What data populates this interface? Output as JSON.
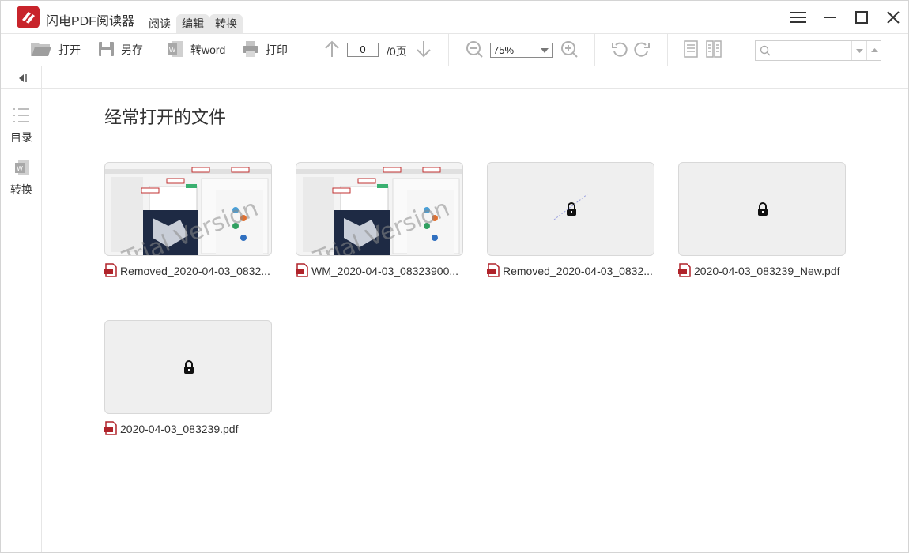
{
  "app": {
    "title": "闪电PDF阅读器"
  },
  "menu_tabs": [
    "阅读",
    "编辑",
    "转换"
  ],
  "toolbar": {
    "open_label": "打开",
    "save_as_label": "另存",
    "to_word_label": "转word",
    "print_label": "打印",
    "page_current": "0",
    "page_total": "/0页",
    "zoom": "75%",
    "search_placeholder": ""
  },
  "sidebar": {
    "toc_label": "目录",
    "convert_label": "转换"
  },
  "main": {
    "section_title": "经常打开的文件",
    "files": [
      {
        "name": "Removed_2020-04-03_0832...",
        "locked": false
      },
      {
        "name": "WM_2020-04-03_08323900...",
        "locked": false
      },
      {
        "name": "Removed_2020-04-03_0832...",
        "locked": true
      },
      {
        "name": "2020-04-03_083239_New.pdf",
        "locked": true
      },
      {
        "name": "2020-04-03_083239.pdf",
        "locked": true
      }
    ],
    "watermark_text": "Trial Version"
  },
  "colors": {
    "brand": "#c8242b",
    "pdf_icon": "#b0232a",
    "border": "#e6e6e6"
  },
  "icons": {
    "window": [
      "menu-icon",
      "minimize-icon",
      "maximize-icon",
      "close-icon"
    ],
    "toolbar": [
      "folder-open-icon",
      "save-icon",
      "word-icon",
      "printer-icon",
      "arrow-up-icon",
      "arrow-down-icon",
      "zoom-out-icon",
      "zoom-in-icon",
      "rotate-left-icon",
      "rotate-right-icon",
      "single-page-icon",
      "double-page-icon",
      "search-icon"
    ]
  }
}
